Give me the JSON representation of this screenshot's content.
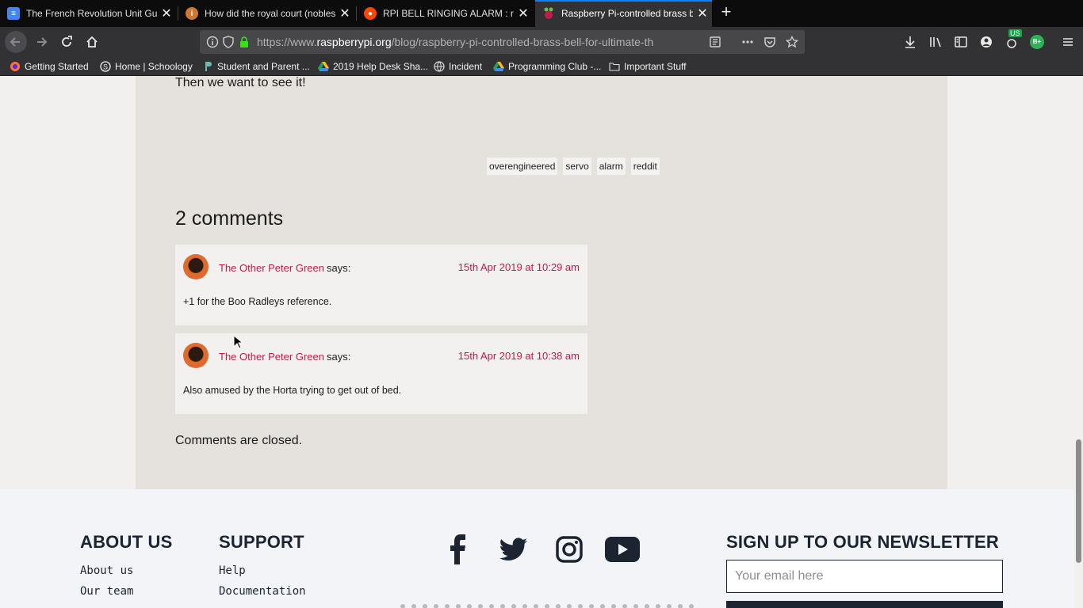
{
  "browser": {
    "tabs": [
      {
        "title": "The French Revolution Unit Gui",
        "favicon_color": "#4285f4"
      },
      {
        "title": "How did the royal court (nobles",
        "favicon_color": "#d07830"
      },
      {
        "title": "RPI BELL RINGING ALARM : ras",
        "favicon_color": "#ff4500"
      },
      {
        "title": "Raspberry Pi-controlled brass b",
        "favicon_color": "#c51a4a"
      }
    ],
    "url_prefix": "https://www.",
    "url_domain": "raspberrypi.org",
    "url_path": "/blog/raspberry-pi-controlled-brass-bell-for-ultimate-th",
    "extension_badge": "US",
    "extension_label": "B+",
    "bookmarks": [
      {
        "label": "Getting Started"
      },
      {
        "label": "Home | Schoology"
      },
      {
        "label": "Student and Parent ..."
      },
      {
        "label": "2019 Help Desk Sha..."
      },
      {
        "label": "Incident"
      },
      {
        "label": "Programming Club -..."
      },
      {
        "label": "Important Stuff"
      }
    ]
  },
  "article": {
    "lead_text": "Then we want to see it!",
    "tags": [
      "overengineered",
      "servo",
      "alarm",
      "reddit"
    ],
    "comments_title": "2 comments",
    "comments": [
      {
        "author": "The Other Peter Green",
        "says": "says:",
        "date": "15th Apr 2019 at 10:29 am",
        "body": "+1 for the Boo Radleys reference."
      },
      {
        "author": "The Other Peter Green",
        "says": "says:",
        "date": "15th Apr 2019 at 10:38 am",
        "body": "Also amused by the Horta trying to get out of bed."
      }
    ],
    "closed_text": "Comments are closed."
  },
  "footer": {
    "about_heading": "ABOUT US",
    "about_links": [
      "About us",
      "Our team"
    ],
    "support_heading": "SUPPORT",
    "support_links": [
      "Help",
      "Documentation"
    ],
    "social": [
      "facebook-icon",
      "twitter-icon",
      "instagram-icon",
      "youtube-icon"
    ],
    "newsletter_heading": "SIGN UP TO OUR NEWSLETTER",
    "email_placeholder": "Your email here"
  },
  "colors": {
    "accent": "#c51a4a",
    "footer_text": "#1b2430",
    "content_bg": "#e5e2dd"
  }
}
